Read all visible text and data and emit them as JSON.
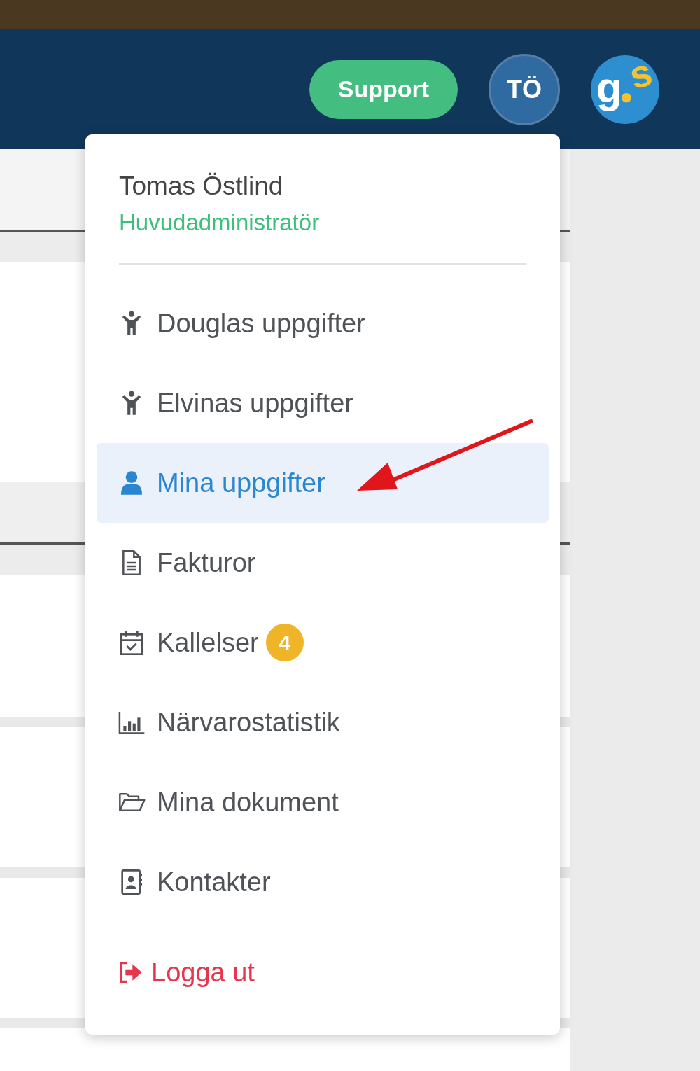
{
  "header": {
    "support_button": "Support",
    "user_initials": "TÖ",
    "logo_letters": [
      "g",
      "s"
    ]
  },
  "menu": {
    "user_name": "Tomas Östlind",
    "role": "Huvudadministratör",
    "items": [
      {
        "label": "Douglas uppgifter",
        "kind": "child",
        "selected": false
      },
      {
        "label": "Elvinas uppgifter",
        "kind": "child",
        "selected": false
      },
      {
        "label": "Mina uppgifter",
        "kind": "user",
        "selected": true
      },
      {
        "label": "Fakturor",
        "kind": "document",
        "selected": false
      },
      {
        "label": "Kallelser",
        "kind": "calendar",
        "selected": false,
        "badge": "4"
      },
      {
        "label": "Närvarostatistik",
        "kind": "chart",
        "selected": false
      },
      {
        "label": "Mina dokument",
        "kind": "folder",
        "selected": false
      },
      {
        "label": "Kontakter",
        "kind": "contacts",
        "selected": false
      }
    ],
    "logout": "Logga ut"
  }
}
